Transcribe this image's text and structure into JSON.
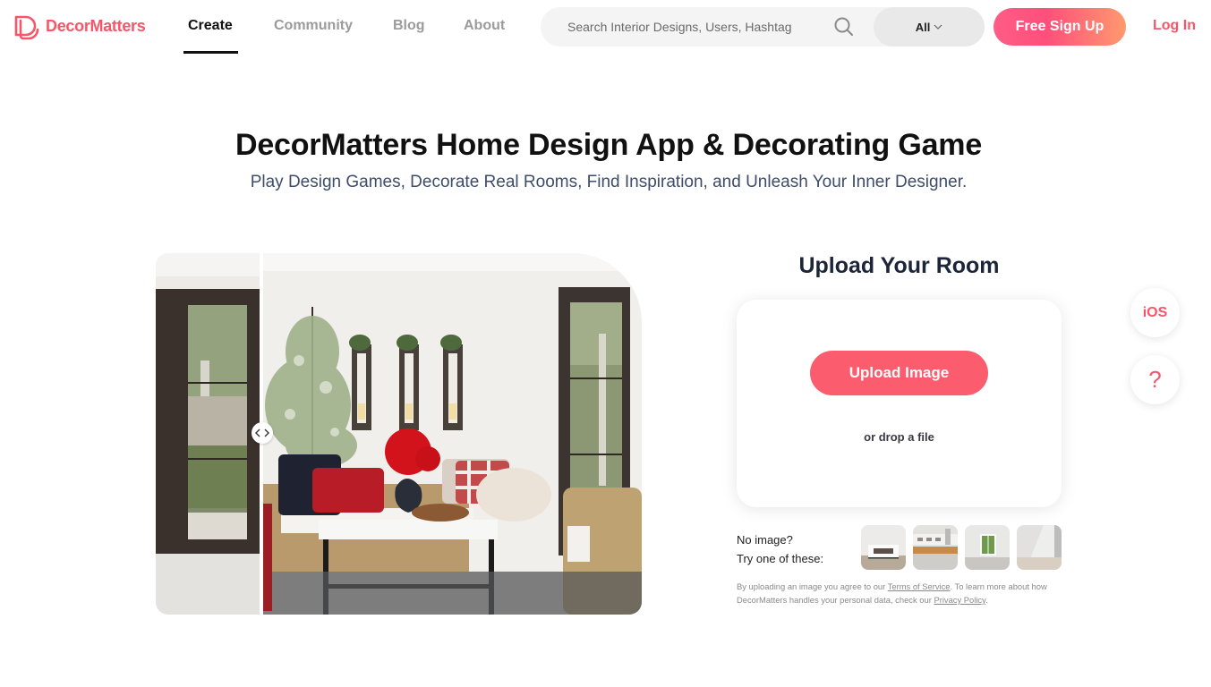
{
  "brand": {
    "name": "DecorMatters",
    "accent_color": "#f7566a",
    "logo_icon": "decormatters-d-logo-icon"
  },
  "nav": {
    "links": [
      {
        "label": "Create",
        "active": true
      },
      {
        "label": "Community",
        "active": false
      },
      {
        "label": "Blog",
        "active": false
      },
      {
        "label": "About",
        "active": false
      }
    ],
    "search": {
      "placeholder": "Search Interior Designs, Users, Hashtag",
      "value": "",
      "icon": "search-icon",
      "filter_selected": "All",
      "filter_icon": "chevron-down-icon"
    },
    "signup_label": "Free Sign Up",
    "login_label": "Log In"
  },
  "hero": {
    "title": "DecorMatters Home Design App & Decorating Game",
    "subtitle": "Play Design Games, Decorate Real Rooms, Find Inspiration, and Unleash Your Inner Designer."
  },
  "compare": {
    "before_label": "empty room with door",
    "after_label": "decorated living room",
    "handle_icon": "left-right-arrows-icon"
  },
  "upload": {
    "title": "Upload Your Room",
    "button_label": "Upload Image",
    "drop_text": "or drop a file",
    "no_image_line1": "No image?",
    "no_image_line2": "Try one of these:",
    "samples": [
      {
        "name": "white room with fireplace"
      },
      {
        "name": "kitchen"
      },
      {
        "name": "empty room with window"
      },
      {
        "name": "empty bright room"
      }
    ],
    "legal": {
      "prefix": "By uploading an image you agree to our ",
      "terms_link": "Terms of Service",
      "middle": ". To learn more about how DecorMatters handles your personal data, check our ",
      "privacy_link": "Privacy Policy",
      "suffix": "."
    }
  },
  "floating": {
    "ios_label": "iOS",
    "help_label": "?"
  }
}
